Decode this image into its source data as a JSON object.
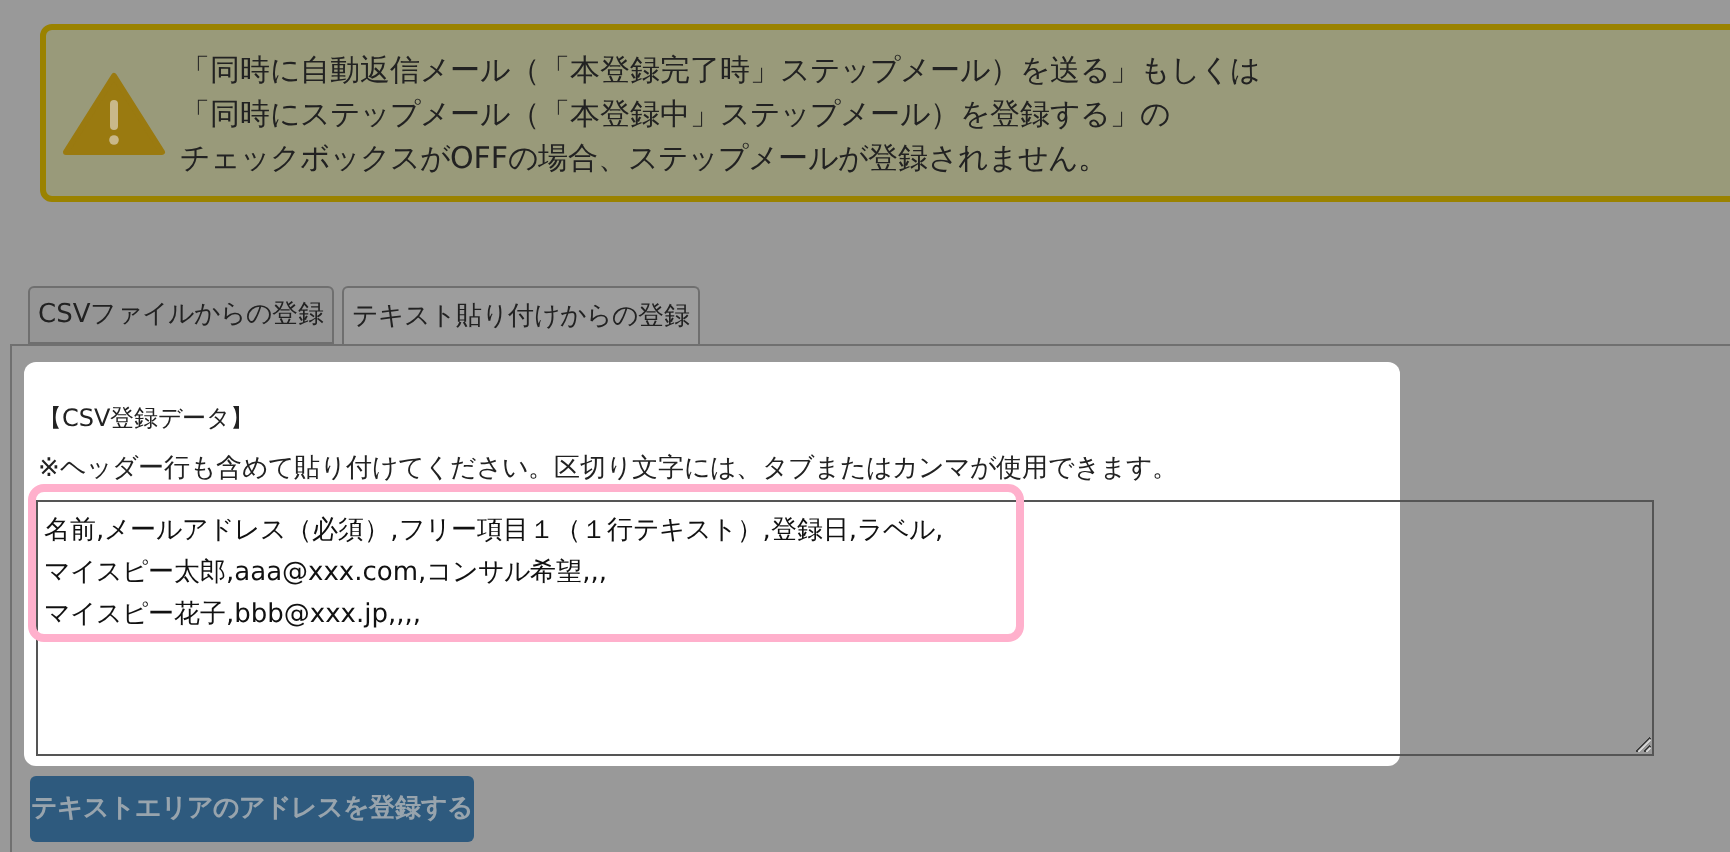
{
  "warning": {
    "lines": [
      "「同時に自動返信メール（「本登録完了時」ステップメール）を送る」もしくは",
      "「同時にステップメール（「本登録中」ステップメール）を登録する」の",
      "チェックボックスがOFFの場合、ステップメールが登録されません。"
    ]
  },
  "tabs": [
    {
      "label": "CSVファイルからの登録",
      "selected": false
    },
    {
      "label": "テキスト貼り付けからの登録",
      "selected": true
    }
  ],
  "panel": {
    "heading": "【CSV登録データ】",
    "notice": "※ヘッダー行も含めて貼り付けてください。区切り文字には、タブまたはカンマが使用できます。",
    "textarea_lines": [
      "名前,メールアドレス（必須）,フリー項目１（１行テキスト）,登録日,ラベル,",
      "マイスピー太郎,aaa@xxx.com,コンサル希望,,,",
      "マイスピー花子,bbb@xxx.jp,,,,"
    ],
    "button": "テキストエリアのアドレスを登録する"
  }
}
